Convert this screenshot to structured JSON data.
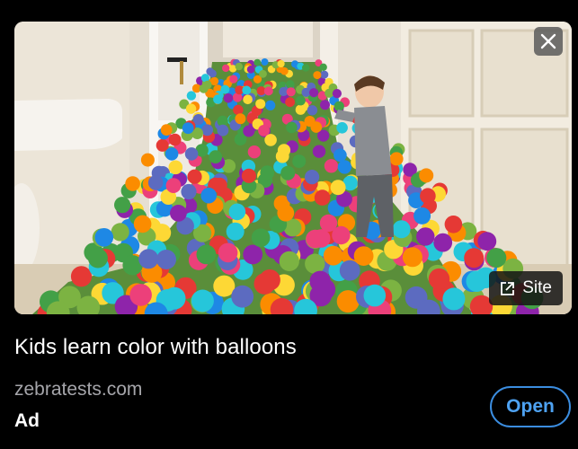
{
  "ad": {
    "title": "Kids learn color with balloons",
    "domain": "zebratests.com",
    "label": "Ad",
    "open_label": "Open",
    "site_label": "Site"
  },
  "icons": {
    "close": "close-icon",
    "external": "external-link-icon"
  },
  "colors": {
    "background": "#000000",
    "accent": "#3b8de0",
    "domain_text": "#a5a5aa"
  }
}
